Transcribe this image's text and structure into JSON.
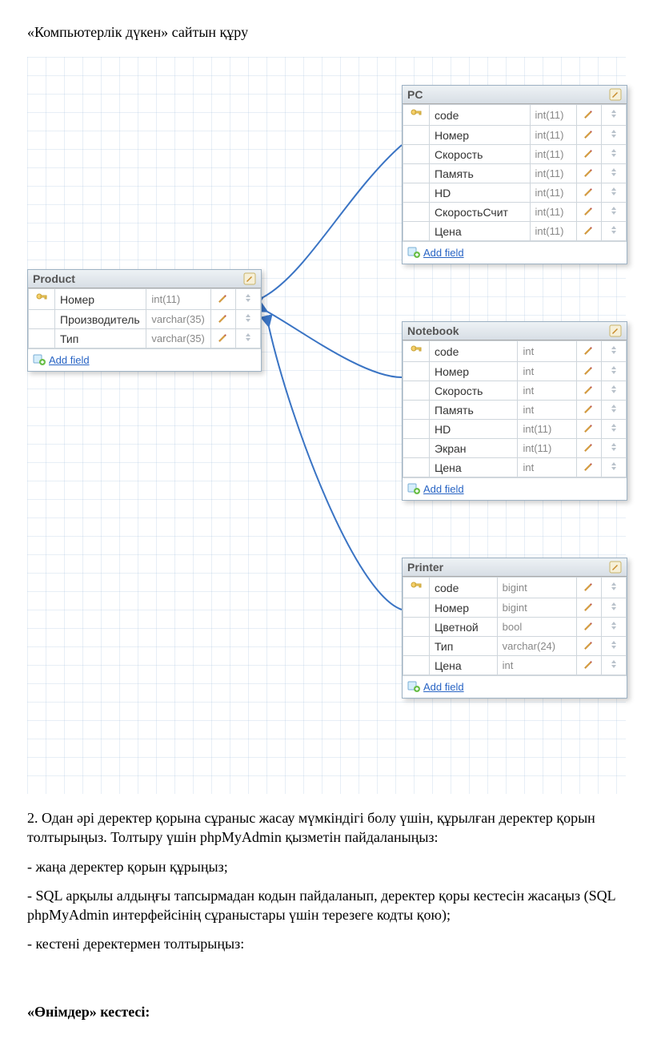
{
  "title": "«Компьютерлік дүкен» сайтын құру",
  "add_field_label": "Add field",
  "tables": {
    "product": {
      "name": "Product",
      "fields": [
        {
          "key": true,
          "name": "Номер",
          "type": "int(11)"
        },
        {
          "key": false,
          "name": "Производитель",
          "type": "varchar(35)"
        },
        {
          "key": false,
          "name": "Тип",
          "type": "varchar(35)"
        }
      ]
    },
    "pc": {
      "name": "PC",
      "fields": [
        {
          "key": true,
          "name": "code",
          "type": "int(11)"
        },
        {
          "key": false,
          "name": "Номер",
          "type": "int(11)"
        },
        {
          "key": false,
          "name": "Скорость",
          "type": "int(11)"
        },
        {
          "key": false,
          "name": "Память",
          "type": "int(11)"
        },
        {
          "key": false,
          "name": "HD",
          "type": "int(11)"
        },
        {
          "key": false,
          "name": "СкоростьСчит",
          "type": "int(11)"
        },
        {
          "key": false,
          "name": "Цена",
          "type": "int(11)"
        }
      ]
    },
    "notebook": {
      "name": "Notebook",
      "fields": [
        {
          "key": true,
          "name": "code",
          "type": "int"
        },
        {
          "key": false,
          "name": "Номер",
          "type": "int"
        },
        {
          "key": false,
          "name": "Скорость",
          "type": "int"
        },
        {
          "key": false,
          "name": "Память",
          "type": "int"
        },
        {
          "key": false,
          "name": "HD",
          "type": "int(11)"
        },
        {
          "key": false,
          "name": "Экран",
          "type": "int(11)"
        },
        {
          "key": false,
          "name": "Цена",
          "type": "int"
        }
      ]
    },
    "printer": {
      "name": "Printer",
      "fields": [
        {
          "key": true,
          "name": "code",
          "type": "bigint"
        },
        {
          "key": false,
          "name": "Номер",
          "type": "bigint"
        },
        {
          "key": false,
          "name": "Цветной",
          "type": "bool"
        },
        {
          "key": false,
          "name": "Тип",
          "type": "varchar(24)"
        },
        {
          "key": false,
          "name": "Цена",
          "type": "int"
        }
      ]
    }
  },
  "body": {
    "p1": "2. Одан әрі деректер қорына сұраныс жасау мүмкіндігі болу үшін, құрылған деректер қорын толтырыңыз. Толтыру үшін phpMyAdmin қызметін пайдаланыңыз:",
    "p2": "- жаңа деректер қорын құрыңыз;",
    "p3": "- SQL арқылы алдыңғы тапсырмадан кодын пайдаланып, деректер қоры кестесін жасаңыз (SQL phpMyAdmin интерфейсінің сұраныстары үшін терезеге кодты қою);",
    "p4": "- кестені деректермен толтырыңыз:",
    "p5": "«Өнімдер» кестесі:"
  }
}
